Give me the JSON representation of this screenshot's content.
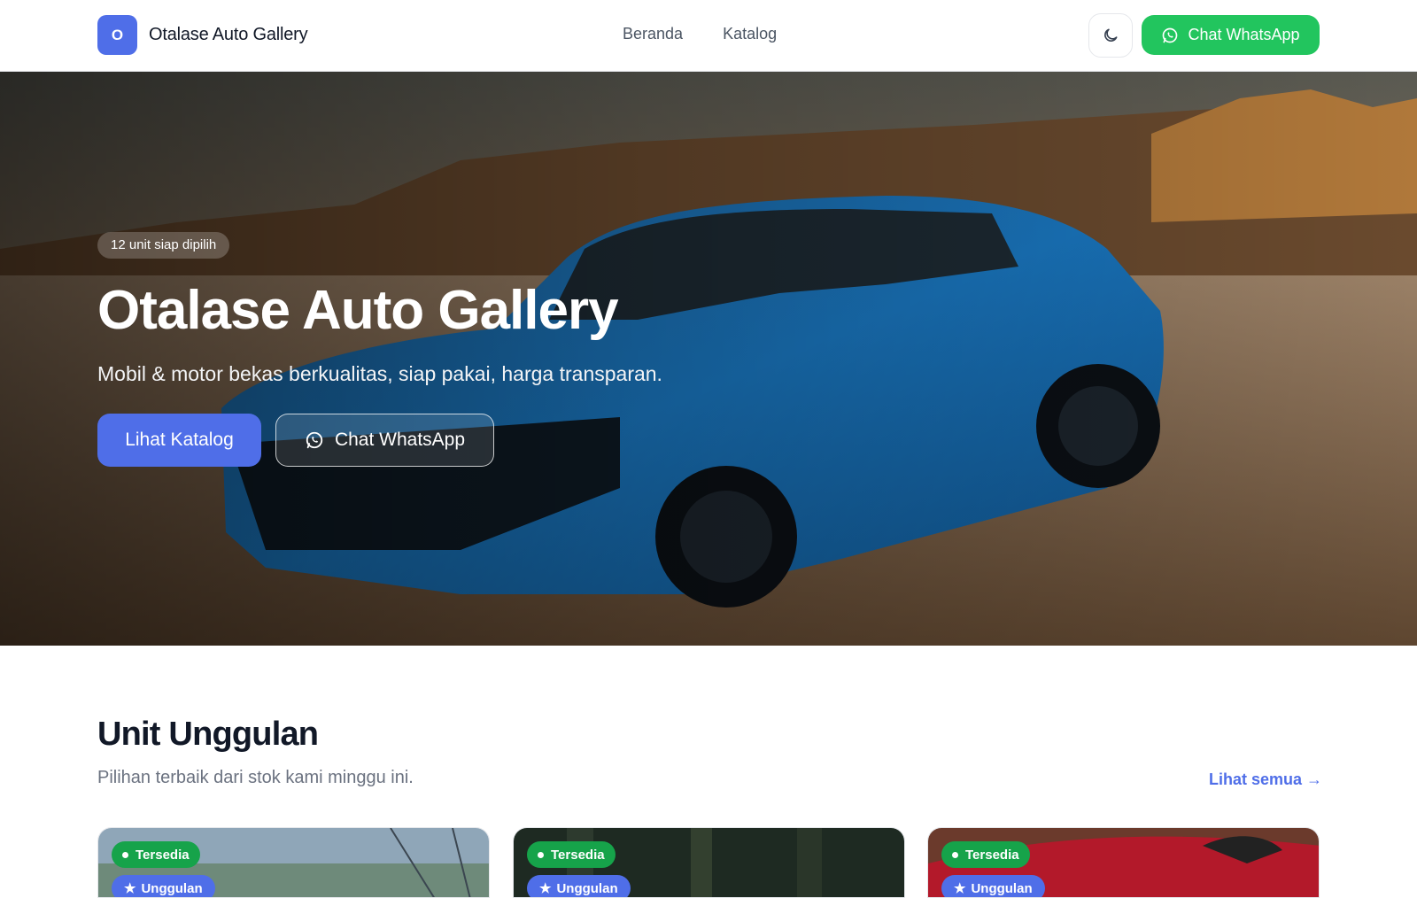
{
  "brand": {
    "logo_letter": "O",
    "name": "Otalase Auto Gallery"
  },
  "nav": {
    "links": [
      {
        "label": "Beranda"
      },
      {
        "label": "Katalog"
      }
    ],
    "whatsapp_label": "Chat WhatsApp"
  },
  "hero": {
    "badge": "12 unit siap dipilih",
    "title": "Otalase Auto Gallery",
    "subtitle": "Mobil & motor bekas berkualitas, siap pakai, harga transparan.",
    "primary_button": "Lihat Katalog",
    "secondary_button": "Chat WhatsApp"
  },
  "featured": {
    "title": "Unit Unggulan",
    "subtitle": "Pilihan terbaik dari stok kami minggu ini.",
    "see_all": "Lihat semua →",
    "cards": [
      {
        "status": "Tersedia",
        "tag": "Unggulan"
      },
      {
        "status": "Tersedia",
        "tag": "Unggulan"
      },
      {
        "status": "Tersedia",
        "tag": "Unggulan"
      }
    ]
  },
  "colors": {
    "accent": "#4f6ee8",
    "whatsapp": "#22c55e",
    "status_green": "#16a34a"
  }
}
